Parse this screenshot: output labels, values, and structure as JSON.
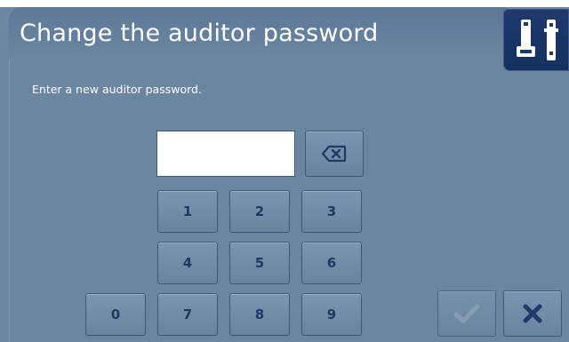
{
  "window": {
    "title": "Change the auditor password"
  },
  "prompt": "Enter a new auditor password.",
  "password_field": {
    "value": "",
    "placeholder": ""
  },
  "keypad": {
    "keys": [
      "1",
      "2",
      "3",
      "4",
      "5",
      "6",
      "0",
      "7",
      "8",
      "9"
    ]
  },
  "icons": {
    "tool": "tool-icon",
    "backspace": "backspace-icon",
    "confirm": "checkmark-icon",
    "cancel": "close-icon"
  },
  "colors": {
    "background": "#6c86a2",
    "titlebar": "#5d7896",
    "tool_button": "#1f3a6b",
    "key_text": "#1d3a66",
    "confirm_disabled": "#8fa4b8",
    "cancel": "#1f3a6b"
  }
}
